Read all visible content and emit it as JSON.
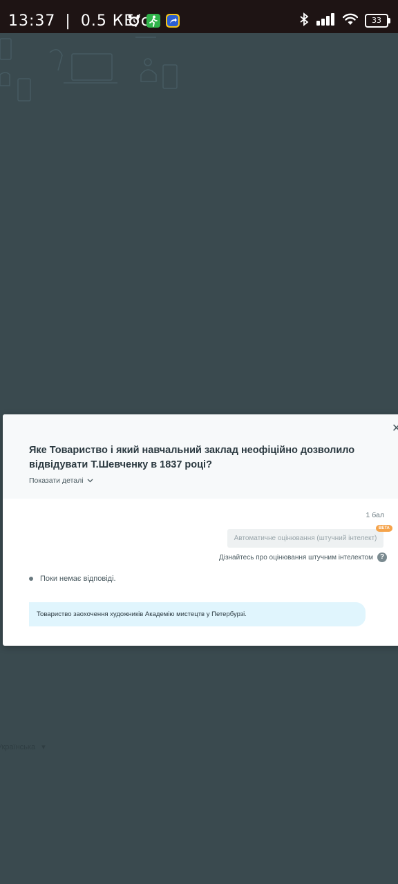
{
  "status_bar": {
    "time": "13:37",
    "separator": "|",
    "net_speed": "0.5 КБ/с",
    "battery": "33"
  },
  "background": {
    "language_selector": "Українська"
  },
  "modal": {
    "question": "Яке Товариство і який навчальний заклад неофіційно дозволило відвідувати Т.Шевченку в 1837 році?",
    "details_toggle": "Показати деталі",
    "points": "1 бал",
    "ai_grading_button": "Автоматичне оцінювання (штучний інтелект)",
    "beta_badge": "BETA",
    "ai_learn_link": "Дізнайтесь про оцінювання штучним інтелектом",
    "help_glyph": "?",
    "no_answer": "Поки немає відповіді.",
    "correct_answer": "Товариство заохочення художників Академію мистецтв у Петербурзі."
  },
  "icons": {
    "close": "close-icon",
    "chevron": "chevron-down-icon",
    "alarm": "alarm-icon",
    "walk": "walking-icon",
    "share": "share-icon",
    "bluetooth": "bluetooth-icon",
    "signal": "signal-icon",
    "wifi": "wifi-icon"
  },
  "colors": {
    "overlay": "#3a4a4f",
    "modal_header": "#f7f9fa",
    "answer_bg": "#e0f5fd",
    "beta": "#f5a34a"
  }
}
